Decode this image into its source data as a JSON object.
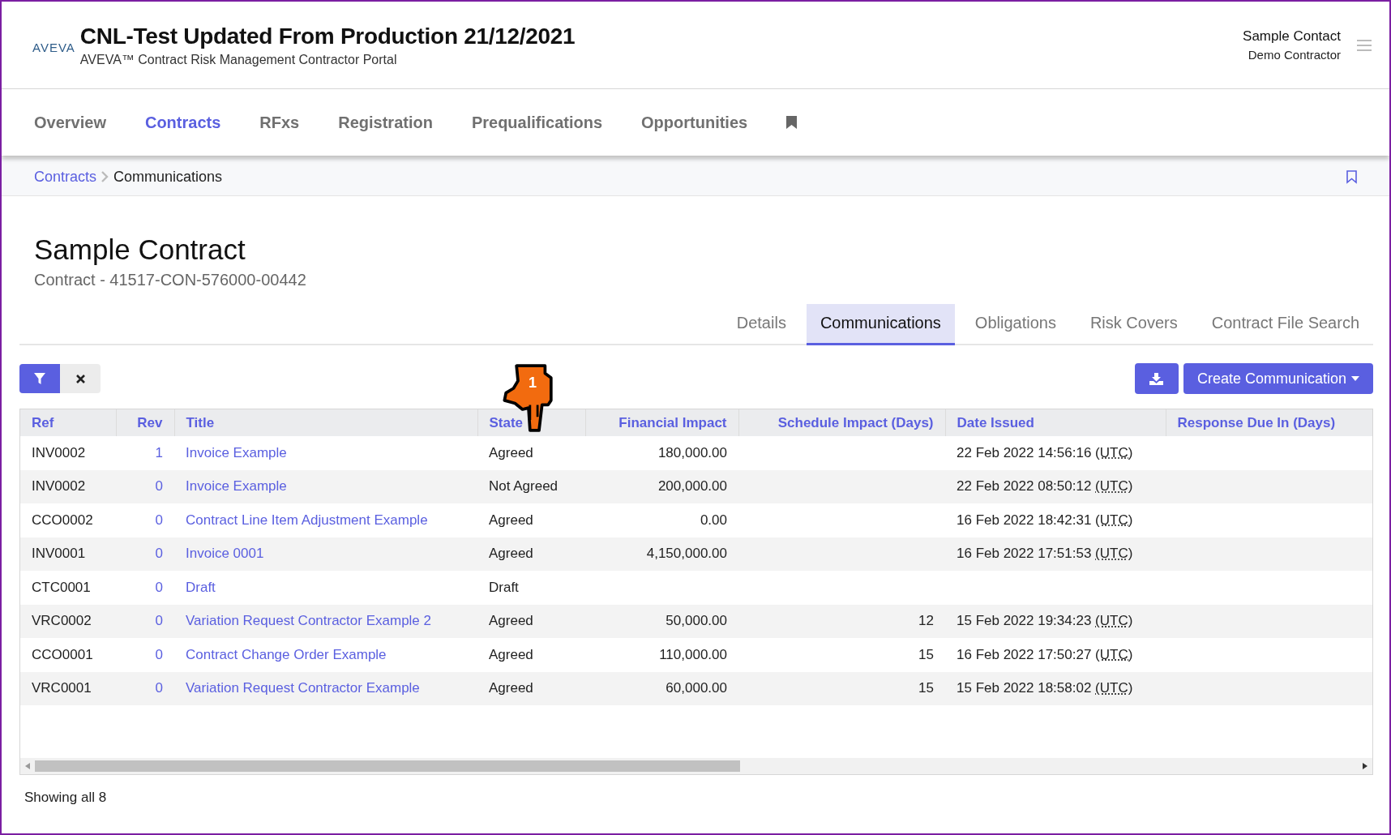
{
  "header": {
    "logo": "AVEVA",
    "title": "CNL-Test Updated From Production 21/12/2021",
    "subtitle": "AVEVA™ Contract Risk Management Contractor Portal",
    "user": {
      "name": "Sample Contact",
      "company": "Demo Contractor"
    }
  },
  "nav": [
    {
      "label": "Overview",
      "selected": false
    },
    {
      "label": "Contracts",
      "selected": true
    },
    {
      "label": "RFxs",
      "selected": false
    },
    {
      "label": "Registration",
      "selected": false
    },
    {
      "label": "Prequalifications",
      "selected": false
    },
    {
      "label": "Opportunities",
      "selected": false
    }
  ],
  "breadcrumb": [
    {
      "label": "Contracts",
      "kind": "link"
    },
    {
      "label": "Communications",
      "kind": "current"
    }
  ],
  "page": {
    "title": "Sample Contract",
    "subtitle": "Contract - 41517-CON-576000-00442"
  },
  "tabs": [
    {
      "label": "Details",
      "selected": false
    },
    {
      "label": "Communications",
      "selected": true
    },
    {
      "label": "Obligations",
      "selected": false
    },
    {
      "label": "Risk Covers",
      "selected": false
    },
    {
      "label": "Contract File Search",
      "selected": false
    }
  ],
  "toolbar": {
    "create_button": "Create Communication"
  },
  "annotation": {
    "number": "1"
  },
  "table": {
    "columns": [
      {
        "label": "Ref"
      },
      {
        "label": "Rev"
      },
      {
        "label": "Title"
      },
      {
        "label": "State"
      },
      {
        "label": "Financial Impact"
      },
      {
        "label": "Schedule Impact (Days)"
      },
      {
        "label": "Date Issued"
      },
      {
        "label": "Response Due In (Days)"
      }
    ],
    "rows": [
      {
        "ref": "INV0002",
        "rev": "1",
        "title": "Invoice Example",
        "state": "Agreed",
        "financial": "180,000.00",
        "date": "22 Feb 2022 14:56:16",
        "tz": "(UTC)"
      },
      {
        "ref": "INV0002",
        "rev": "0",
        "title": "Invoice Example",
        "state": "Not Agreed",
        "financial": "200,000.00",
        "date": "22 Feb 2022 08:50:12",
        "tz": "(UTC)"
      },
      {
        "ref": "CCO0002",
        "rev": "0",
        "title": "Contract Line Item Adjustment Example",
        "state": "Agreed",
        "financial": "0.00",
        "date": "16 Feb 2022 18:42:31",
        "tz": "(UTC)"
      },
      {
        "ref": "INV0001",
        "rev": "0",
        "title": "Invoice 0001",
        "state": "Agreed",
        "financial": "4,150,000.00",
        "date": "16 Feb 2022 17:51:53",
        "tz": "(UTC)"
      },
      {
        "ref": "CTC0001",
        "rev": "0",
        "title": "Draft",
        "state": "Draft"
      },
      {
        "ref": "VRC0002",
        "rev": "0",
        "title": "Variation Request Contractor Example 2",
        "state": "Agreed",
        "financial": "50,000.00",
        "schedule": "12",
        "date": "15 Feb 2022 19:34:23",
        "tz": "(UTC)"
      },
      {
        "ref": "CCO0001",
        "rev": "0",
        "title": "Contract Change Order Example",
        "state": "Agreed",
        "financial": "110,000.00",
        "schedule": "15",
        "date": "16 Feb 2022 17:50:27",
        "tz": "(UTC)"
      },
      {
        "ref": "VRC0001",
        "rev": "0",
        "title": "Variation Request Contractor Example",
        "state": "Agreed",
        "financial": "60,000.00",
        "schedule": "15",
        "date": "15 Feb 2022 18:58:02",
        "tz": "(UTC)"
      }
    ]
  },
  "footer": "Showing all 8"
}
